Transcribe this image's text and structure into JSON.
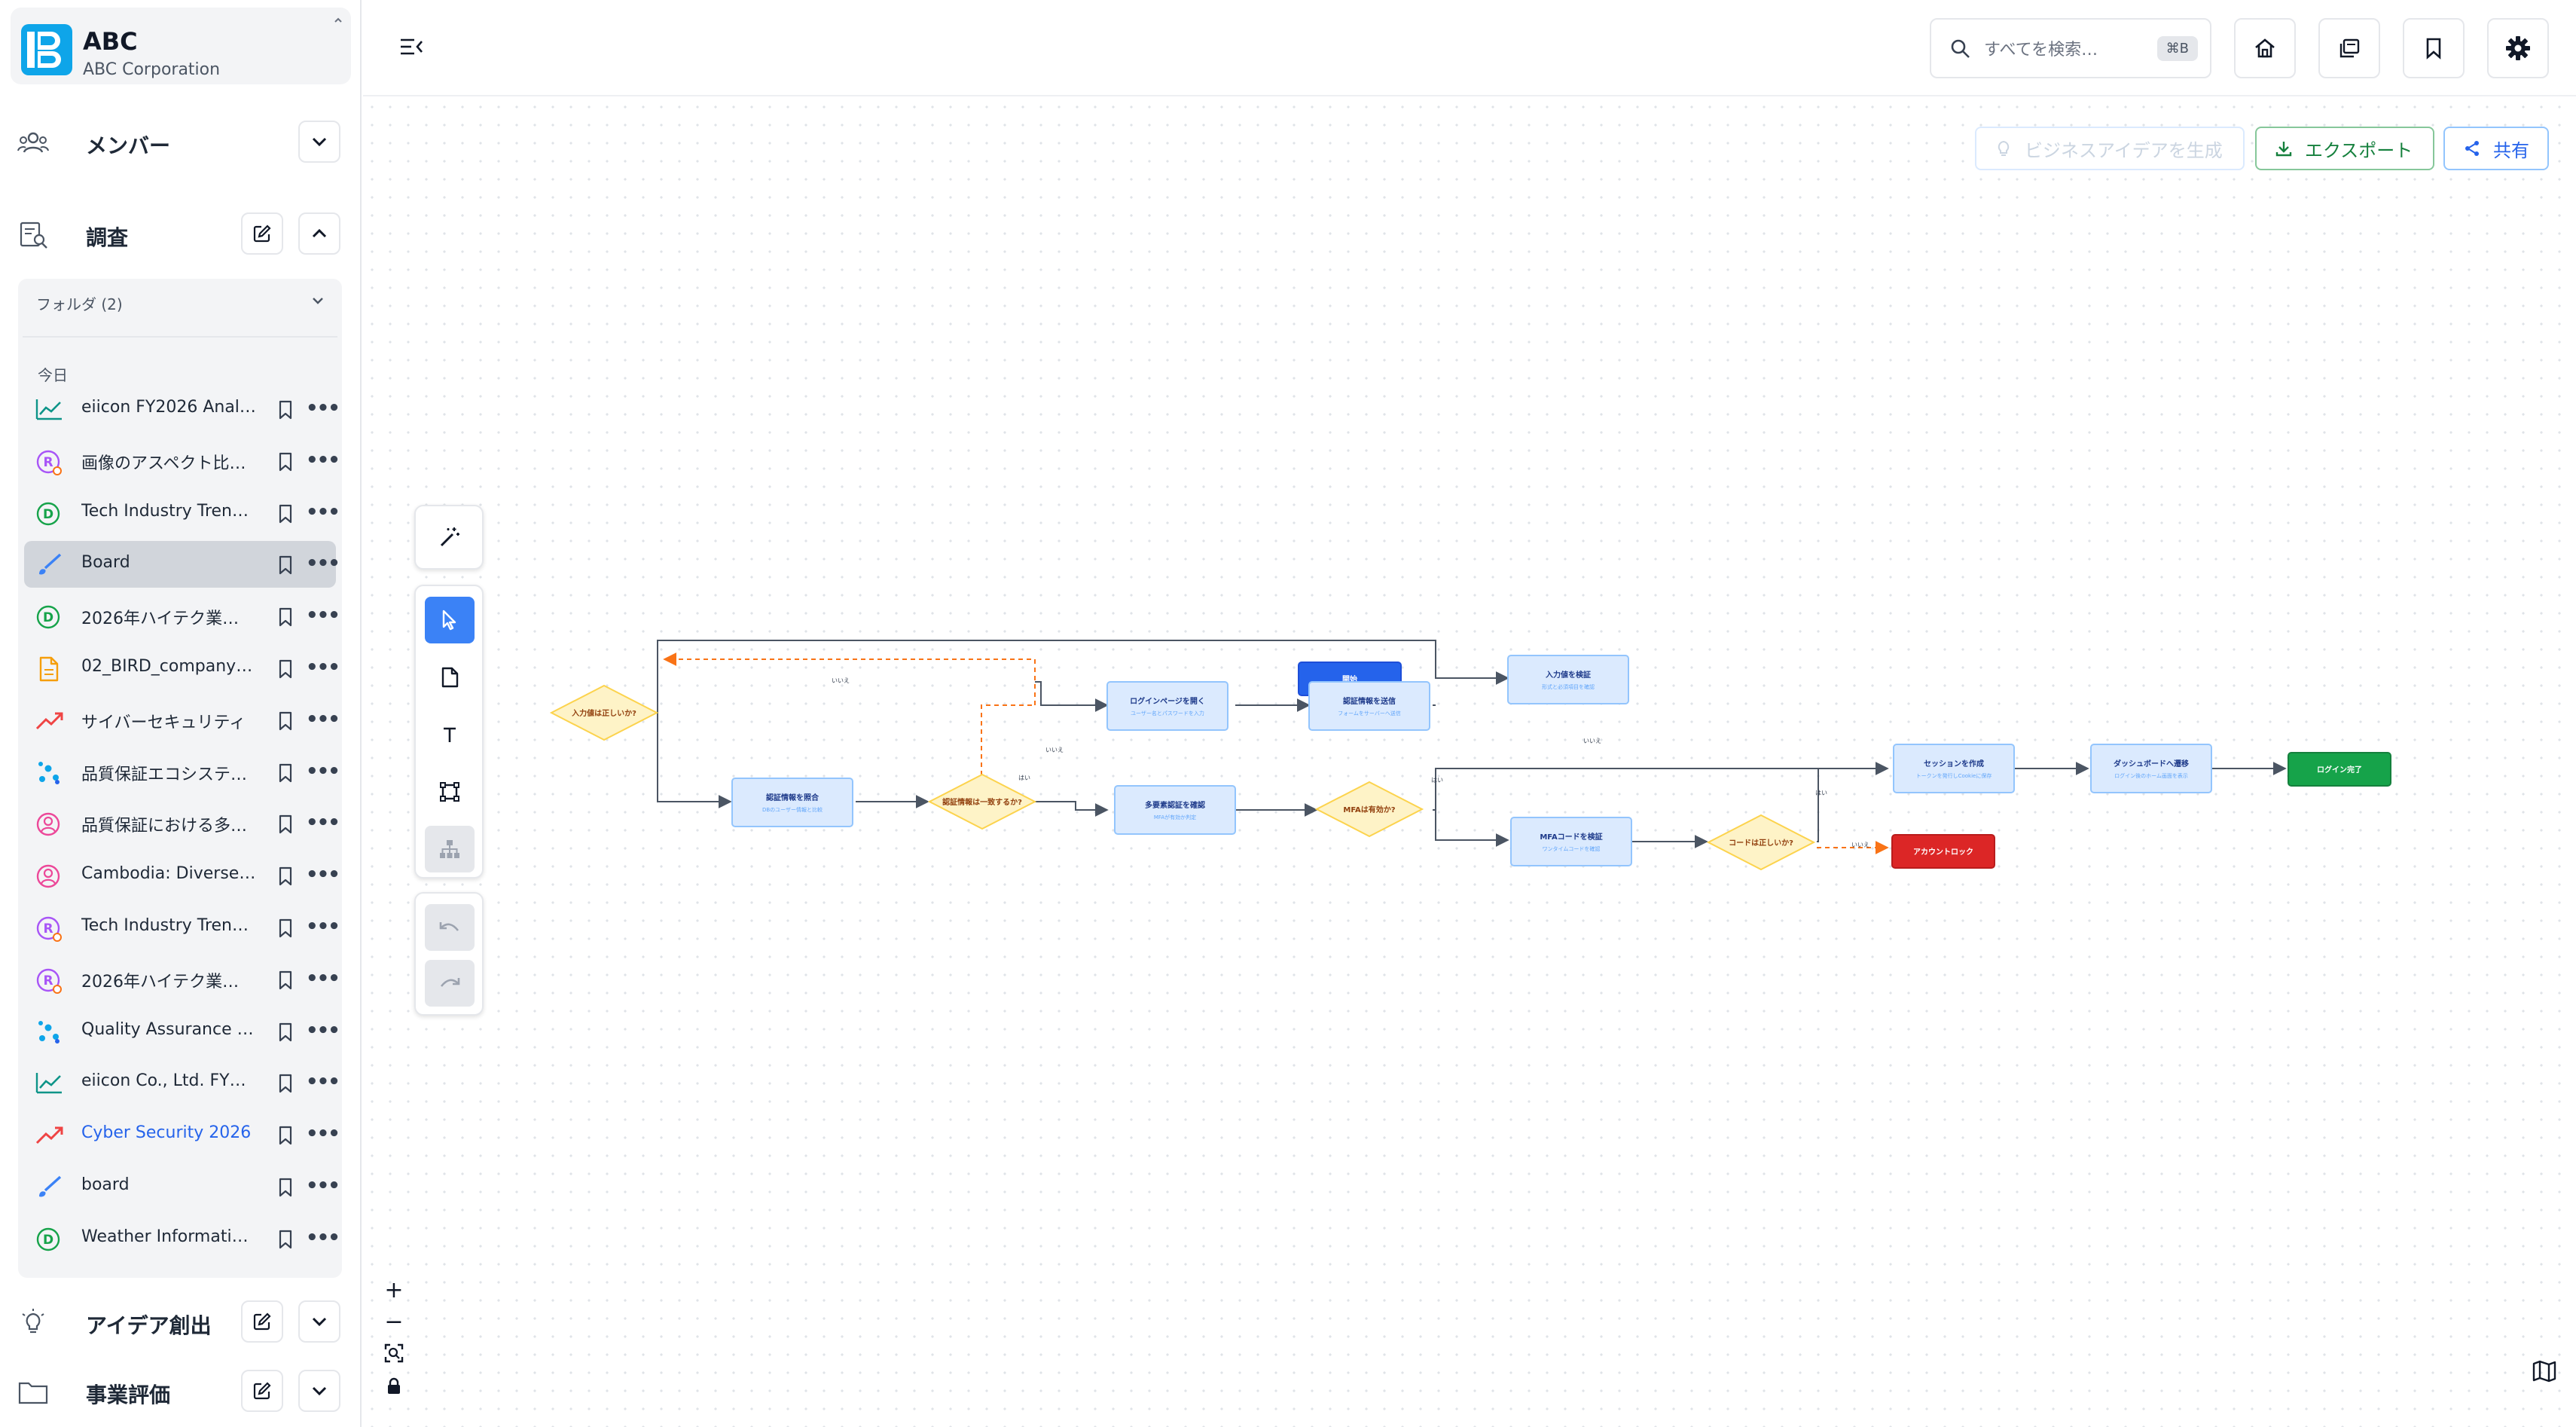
{
  "org": {
    "name": "ABC",
    "subtitle": "ABC Corporation"
  },
  "sidebar": {
    "members_label": "メンバー",
    "research_label": "調査",
    "folders_label": "フォルダ (2)",
    "today_label": "今日",
    "items": [
      {
        "label": "eiicon FY2026 Anal…",
        "icon": "trend-line-icon",
        "color": "#0d9488"
      },
      {
        "label": "画像のアスペクト比…",
        "icon": "research-r-icon",
        "color": "#a855f7"
      },
      {
        "label": "Tech Industry Trend…",
        "icon": "document-d-icon",
        "color": "#16a34a"
      },
      {
        "label": "Board",
        "icon": "paintbrush-icon",
        "color": "#3b82f6",
        "active": true
      },
      {
        "label": "2026年ハイテク業…",
        "icon": "document-d-icon",
        "color": "#16a34a"
      },
      {
        "label": "02_BIRD_company_…",
        "icon": "file-icon",
        "color": "#f59e0b"
      },
      {
        "label": "サイバーセキュリティ",
        "icon": "trend-up-icon",
        "color": "#ef4444"
      },
      {
        "label": "品質保証エコシステ…",
        "icon": "scatter-icon",
        "color": "#0ea5e9"
      },
      {
        "label": "品質保証における多…",
        "icon": "persona-icon",
        "color": "#ec4899"
      },
      {
        "label": "Cambodia: Diverse …",
        "icon": "persona-icon",
        "color": "#ec4899"
      },
      {
        "label": "Tech Industry Trend…",
        "icon": "research-r-icon",
        "color": "#a855f7"
      },
      {
        "label": "2026年ハイテク業…",
        "icon": "research-r-icon",
        "color": "#a855f7"
      },
      {
        "label": "Quality Assurance …",
        "icon": "scatter-icon",
        "color": "#0ea5e9"
      },
      {
        "label": "eiicon Co., Ltd. FY2…",
        "icon": "trend-line-icon",
        "color": "#0d9488"
      },
      {
        "label": "Cyber Security 2026",
        "icon": "trend-up-icon",
        "color": "#ef4444",
        "link": true
      },
      {
        "label": "board",
        "icon": "paintbrush-icon",
        "color": "#3b82f6"
      },
      {
        "label": "Weather Informatio…",
        "icon": "document-d-icon",
        "color": "#16a34a"
      }
    ],
    "ideation_label": "アイデア創出",
    "evaluation_label": "事業評価"
  },
  "topbar": {
    "search_placeholder": "すべてを検索…",
    "search_shortcut": "⌘B"
  },
  "actions": {
    "idea_label": "ビジネスアイデアを生成",
    "export_label": "エクスポート",
    "share_label": "共有"
  },
  "zoom": {
    "in": "+",
    "out": "−"
  },
  "flow": {
    "nodes": [
      {
        "id": "start",
        "type": "start",
        "title": "開始",
        "sub": ""
      },
      {
        "id": "n1",
        "type": "process",
        "title": "ログインページを開く",
        "sub": "ユーザー名とパスワードを入力"
      },
      {
        "id": "n2",
        "type": "process",
        "title": "認証情報を送信",
        "sub": "フォームをサーバーへ送信"
      },
      {
        "id": "n3",
        "type": "process",
        "title": "入力値を検証",
        "sub": "形式と必須項目を確認"
      },
      {
        "id": "d1",
        "type": "decision",
        "title": "入力値は正しいか?",
        "sub": ""
      },
      {
        "id": "n4",
        "type": "process",
        "title": "認証情報を照合",
        "sub": "DBのユーザー情報と比較"
      },
      {
        "id": "d2",
        "type": "decision",
        "title": "認証情報は一致するか?",
        "sub": ""
      },
      {
        "id": "n5",
        "type": "process",
        "title": "多要素認証を確認",
        "sub": "MFAが有効か判定"
      },
      {
        "id": "d3",
        "type": "decision",
        "title": "MFAは有効か?",
        "sub": ""
      },
      {
        "id": "n6",
        "type": "process",
        "title": "MFAコードを検証",
        "sub": "ワンタイムコードを確認"
      },
      {
        "id": "d4",
        "type": "decision",
        "title": "コードは正しいか?",
        "sub": ""
      },
      {
        "id": "n7",
        "type": "process",
        "title": "セッションを作成",
        "sub": "トークンを発行しCookieに保存"
      },
      {
        "id": "n8",
        "type": "process",
        "title": "ダッシュボードへ遷移",
        "sub": "ログイン後のホーム画面を表示"
      },
      {
        "id": "end",
        "type": "success",
        "title": "ログイン完了",
        "sub": ""
      },
      {
        "id": "lock",
        "type": "error",
        "title": "アカウントロック",
        "sub": ""
      }
    ],
    "edge_labels": [
      "いいえ",
      "いいえ",
      "はい",
      "いいえ",
      "はい",
      "はい",
      "いいえ"
    ]
  }
}
